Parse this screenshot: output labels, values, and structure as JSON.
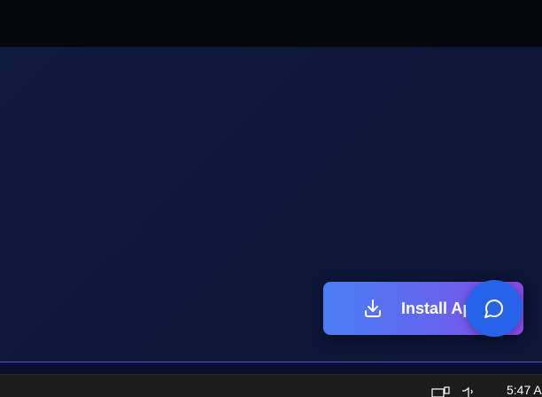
{
  "install_button": {
    "label": "Install App",
    "icon": "download-icon"
  },
  "chat_button": {
    "icon": "chat-bubble-icon"
  },
  "taskbar": {
    "clock": "5:47 A",
    "tray_icons": [
      "display-icon",
      "volume-icon"
    ]
  },
  "colors": {
    "background": "#0f1330",
    "topbar": "#05070d",
    "install_gradient_start": "#4a7ef5",
    "install_gradient_end": "#8b49e8",
    "chat_button": "#2563eb",
    "accent_line": "#5b4bd6",
    "taskbar": "#1c1c1c"
  }
}
